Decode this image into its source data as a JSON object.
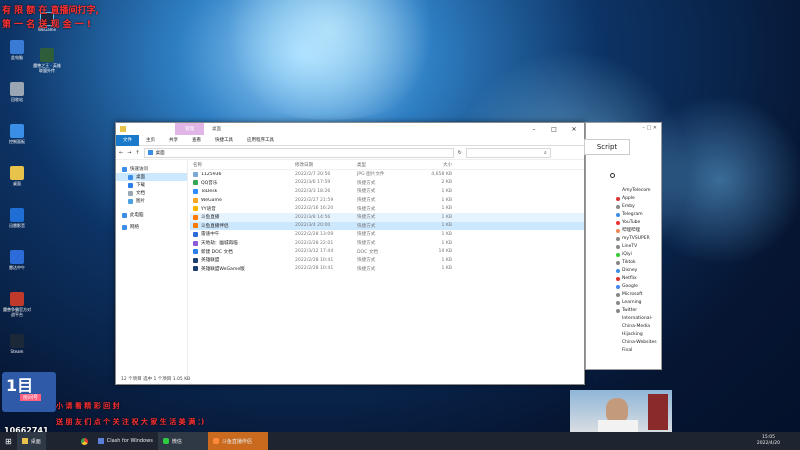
{
  "overlay": {
    "line1": "有 限 额 在 直播间打字,",
    "line2": "第 一 名 送 现 金 一 !",
    "line3": "小 请 看 精 彩 回 封",
    "line4": "送 朋 友 们 点 个 关 注 祝 大 家 生 活 美 满 ：)",
    "room_id": "10662741",
    "room_label": "房间号"
  },
  "desktop": [
    {
      "label": "此电脑"
    },
    {
      "label": "回收站"
    },
    {
      "label": "控制面板"
    },
    {
      "label": "桌面"
    },
    {
      "label": "迅雷影音"
    },
    {
      "label": "雷达中午"
    },
    {
      "label": "魔兽争霸官方对战平台"
    },
    {
      "label": "Steam"
    },
    {
      "label": "Clash for Windows"
    }
  ],
  "desktop_top": [
    {
      "label": "WeGame"
    },
    {
      "label": "魔兽之王 · 英雄联盟外传"
    }
  ],
  "explorer": {
    "title_tab1": "管理",
    "title_tab2": "管理",
    "title": "桌面",
    "ribbon": [
      "文件",
      "主页",
      "共享",
      "查看",
      "快捷工具",
      "应用程序工具"
    ],
    "address": "桌面",
    "search_icon": "⌕",
    "nav": [
      {
        "label": "快速访问"
      },
      {
        "label": "桌面"
      },
      {
        "label": "下载"
      },
      {
        "label": "文档"
      },
      {
        "label": "图片"
      },
      {
        "label": "此电脑"
      },
      {
        "label": "网络"
      }
    ],
    "headers": [
      "名称",
      "修改日期",
      "类型",
      "大小"
    ],
    "files": [
      {
        "name": "1125936",
        "date": "2022/2/7 20:56",
        "type": "JPG 图片文件",
        "size": "4,658 KB"
      },
      {
        "name": "QQ音乐",
        "date": "2022/3/6 17:59",
        "type": "快捷方式",
        "size": "2 KB"
      },
      {
        "name": "ToDesk",
        "date": "2022/3/3 18:26",
        "type": "快捷方式",
        "size": "1 KB"
      },
      {
        "name": "WeGame",
        "date": "2022/2/27 21:59",
        "type": "快捷方式",
        "size": "1 KB"
      },
      {
        "name": "YY语音",
        "date": "2022/2/16 16:20",
        "type": "快捷方式",
        "size": "1 KB"
      },
      {
        "name": "斗鱼直播",
        "date": "2022/3/8 14:56",
        "type": "快捷方式",
        "size": "1 KB"
      },
      {
        "name": "斗鱼直播伴侣",
        "date": "2022/3/4 20:00",
        "type": "快捷方式",
        "size": "1 KB"
      },
      {
        "name": "雷速中午",
        "date": "2022/2/28 13:09",
        "type": "快捷方式",
        "size": "1 KB"
      },
      {
        "name": "天地劫：幽城再临",
        "date": "2022/2/28 22:01",
        "type": "快捷方式",
        "size": "1 KB"
      },
      {
        "name": "新建 DOC 文档",
        "date": "2022/3/12 17:44",
        "type": "DOC 文档",
        "size": "10 KB"
      },
      {
        "name": "英雄联盟",
        "date": "2022/2/28 10:41",
        "type": "快捷方式",
        "size": "1 KB"
      },
      {
        "name": "英雄联盟WeGame版",
        "date": "2022/2/28 10:41",
        "type": "快捷方式",
        "size": "1 KB"
      }
    ],
    "status": "12 个项目    选中 1 个项目 1.05 KB"
  },
  "clash": {
    "script_label": "Script",
    "rules": [
      "AmyTelecom",
      "Apple",
      "Emby",
      "Telegram",
      "YouTube",
      "哔哩哔哩",
      "myTVSUPER",
      "LineTV",
      "iQiyi",
      "Tiktok",
      "Disney",
      "Netflix",
      "Google",
      "Microsoft",
      "Learning",
      "Twitter",
      "International-",
      "China-Media",
      "Hijacking",
      "China-Websites",
      "Final"
    ]
  },
  "taskbar": {
    "items": [
      "桌面",
      "Clash for Windows",
      "微信",
      "斗鱼直播伴侣"
    ],
    "time": "15:05",
    "date": "2022/4/20"
  },
  "colors": {
    "accent": "#1979ca",
    "ctx_pink": "#f2b9ce",
    "ctx_purple": "#e1b6e6",
    "overlay_red": "#ff3030"
  }
}
